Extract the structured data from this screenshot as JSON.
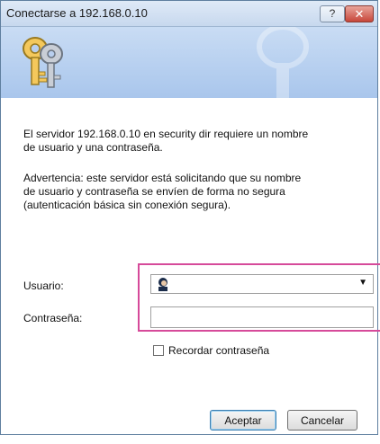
{
  "window": {
    "title": "Conectarse a 192.168.0.10",
    "help_label": "?",
    "close_label": "✕"
  },
  "icons": {
    "banner": "keys-icon",
    "user": "user-avatar-icon",
    "dropdown": "chevron-down-icon"
  },
  "message": {
    "line1": "El servidor 192.168.0.10  en security dir requiere un nombre",
    "line2": "de usuario y una contraseña.",
    "warning1": "Advertencia: este servidor está solicitando que su nombre",
    "warning2": "de usuario y contraseña se envíen de forma no segura",
    "warning3": "(autenticación básica sin conexión segura)."
  },
  "form": {
    "username_label": "Usuario:",
    "password_label": "Contraseña:",
    "password_value": "",
    "remember_label": "Recordar contraseña",
    "remember_checked": false
  },
  "buttons": {
    "accept": "Aceptar",
    "cancel": "Cancelar"
  },
  "colors": {
    "highlight": "#d64a9a",
    "banner": "#b7cff0"
  }
}
